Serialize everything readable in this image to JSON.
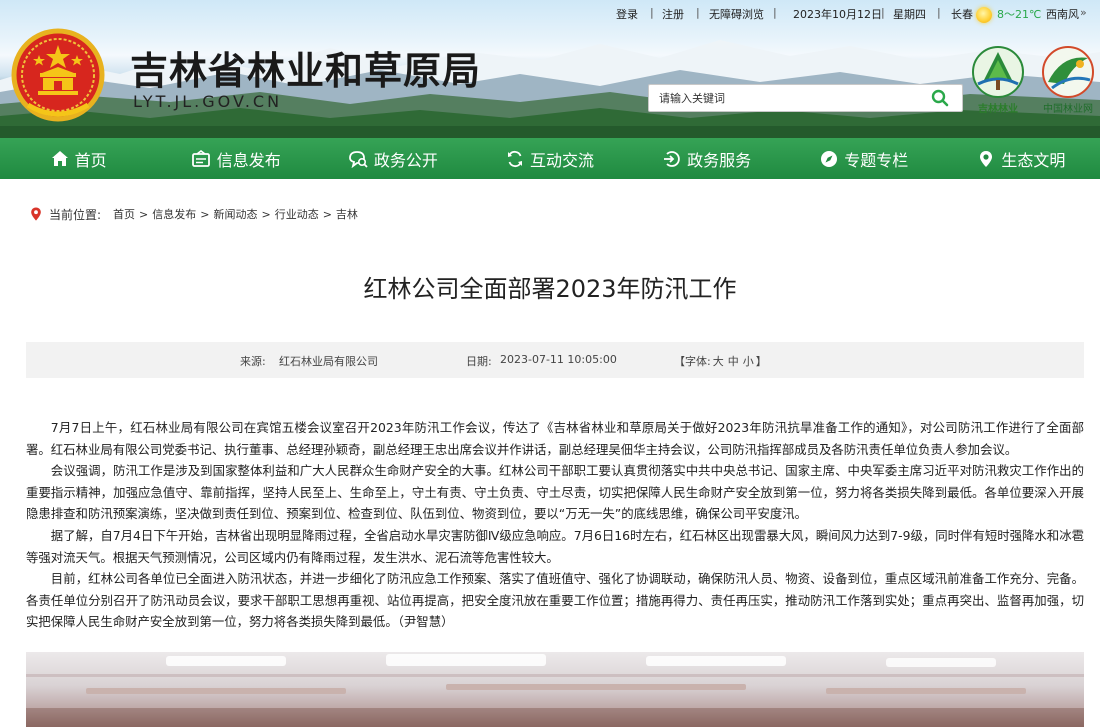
{
  "topbar": {
    "login": "登录",
    "register": "注册",
    "accessibility": "无障碍浏览",
    "date": "2023年10月12日",
    "weekday": "星期四",
    "city": "长春",
    "temperature": "8～21℃",
    "wind": "西南风",
    "more": "»",
    "sep": "|"
  },
  "header": {
    "title": "吉林省林业和草原局",
    "domain": "LYT.JL.GOV.CN",
    "search_placeholder": "请输入关键词",
    "logo_jilin": "吉林林业",
    "logo_china": "中国林业网"
  },
  "nav": {
    "items": [
      {
        "label": "首页",
        "icon": "home-icon"
      },
      {
        "label": "信息发布",
        "icon": "info-release-icon"
      },
      {
        "label": "政务公开",
        "icon": "gov-affairs-icon"
      },
      {
        "label": "互动交流",
        "icon": "interaction-icon"
      },
      {
        "label": "政务服务",
        "icon": "service-icon"
      },
      {
        "label": "专题专栏",
        "icon": "topic-icon"
      },
      {
        "label": "生态文明",
        "icon": "ecology-icon"
      }
    ]
  },
  "breadcrumb": {
    "label": "当前位置:",
    "items": [
      "首页",
      "信息发布",
      "新闻动态",
      "行业动态",
      "吉林"
    ],
    "separator": ">"
  },
  "article": {
    "title": "红林公司全面部署2023年防汛工作",
    "source_label": "来源:",
    "source": "红石林业局有限公司",
    "date_label": "日期:",
    "date": "2023-07-11 10:05:00",
    "font_label": "【字体:",
    "font_large": "大",
    "font_medium": "中",
    "font_small": "小",
    "font_close": "】",
    "paragraphs": [
      "7月7日上午，红石林业局有限公司在宾馆五楼会议室召开2023年防汛工作会议，传达了《吉林省林业和草原局关于做好2023年防汛抗旱准备工作的通知》，对公司防汛工作进行了全面部署。红石林业局有限公司党委书记、执行董事、总经理孙颖奇，副总经理王忠出席会议并作讲话，副总经理吴佃华主持会议，公司防汛指挥部成员及各防汛责任单位负责人参加会议。",
      "会议强调，防汛工作是涉及到国家整体利益和广大人民群众生命财产安全的大事。红林公司干部职工要认真贯彻落实中共中央总书记、国家主席、中央军委主席习近平对防汛救灾工作作出的重要指示精神，加强应急值守、靠前指挥，坚持人民至上、生命至上，守土有责、守土负责、守土尽责，切实把保障人民生命财产安全放到第一位，努力将各类损失降到最低。各单位要深入开展隐患排查和防汛预案演练，坚决做到责任到位、预案到位、检查到位、队伍到位、物资到位，要以“万无一失”的底线思维，确保公司平安度汛。",
      "据了解，自7月4日下午开始，吉林省出现明显降雨过程，全省启动水旱灾害防御Ⅳ级应急响应。7月6日16时左右，红石林区出现雷暴大风，瞬间风力达到7-9级，同时伴有短时强降水和冰雹等强对流天气。根据天气预测情况，公司区域内仍有降雨过程，发生洪水、泥石流等危害性较大。",
      "目前，红林公司各单位已全面进入防汛状态，并进一步细化了防汛应急工作预案、落实了值班值守、强化了协调联动，确保防汛人员、物资、设备到位，重点区域汛前准备工作充分、完备。各责任单位分别召开了防汛动员会议，要求干部职工思想再重视、站位再提高，把安全度汛放在重要工作位置；措施再得力、责任再压实，推动防汛工作落到实处；重点再突出、监督再加强，切实把保障人民生命财产安全放到第一位，努力将各类损失降到最低。（尹智慧）"
    ]
  },
  "colors": {
    "nav_green": "#1f8a40",
    "search_icon": "#2aa84a",
    "breadcrumb_pin": "#d9352a"
  }
}
